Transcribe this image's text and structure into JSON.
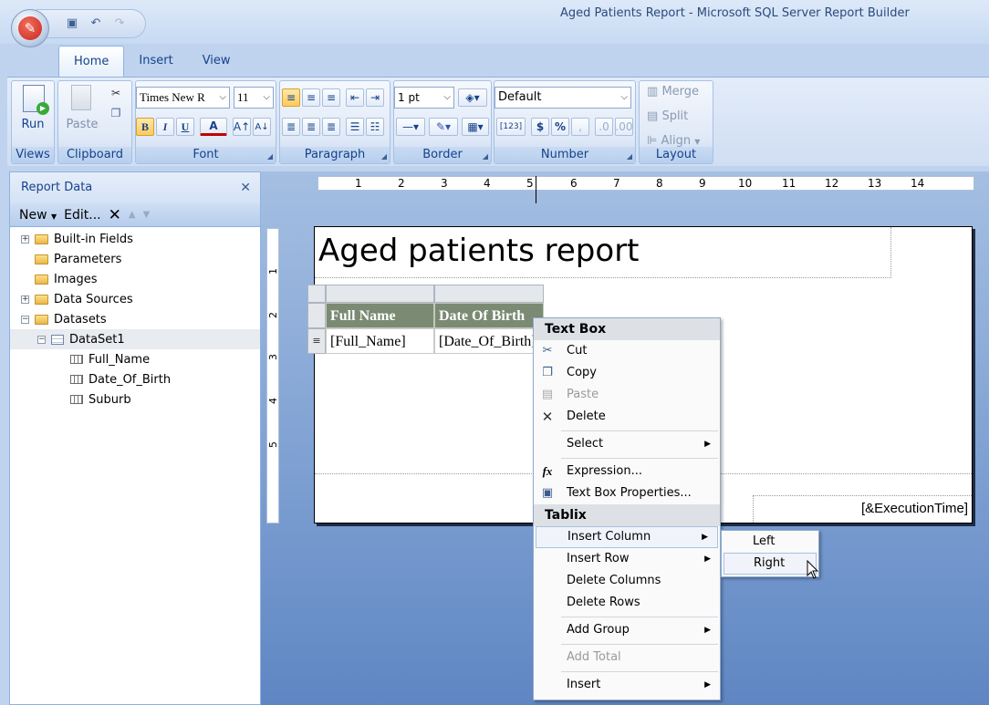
{
  "window": {
    "title": "Aged Patients Report - Microsoft SQL Server Report Builder"
  },
  "qat": {
    "icons": [
      "save-icon",
      "undo-icon",
      "redo-icon"
    ]
  },
  "tabs": [
    {
      "label": "Home"
    },
    {
      "label": "Insert"
    },
    {
      "label": "View"
    }
  ],
  "ribbon": {
    "views": {
      "run": "Run",
      "label": "Views"
    },
    "clipboard": {
      "paste": "Paste",
      "label": "Clipboard"
    },
    "font": {
      "family": "Times New R",
      "size": "11",
      "label": "Font",
      "bold": "B",
      "italic": "I",
      "underline": "U",
      "color": "A"
    },
    "paragraph": {
      "label": "Paragraph"
    },
    "border": {
      "width": "1 pt",
      "label": "Border"
    },
    "number": {
      "format": "Default",
      "label": "Number",
      "placeholder_btn": "[123]",
      "currency": "$",
      "percent": "%",
      "comma": ","
    },
    "layout": {
      "merge": "Merge",
      "split": "Split",
      "align": "Align",
      "label": "Layout"
    }
  },
  "report_data": {
    "title": "Report Data",
    "toolbar": {
      "new": "New",
      "edit": "Edit..."
    },
    "tree": [
      {
        "label": "Built-in Fields",
        "expander": "+"
      },
      {
        "label": "Parameters",
        "expander": ""
      },
      {
        "label": "Images",
        "expander": ""
      },
      {
        "label": "Data Sources",
        "expander": "+"
      },
      {
        "label": "Datasets",
        "expander": "−"
      },
      {
        "label": "DataSet1",
        "expander": "−"
      },
      {
        "label": "Full_Name"
      },
      {
        "label": "Date_Of_Birth"
      },
      {
        "label": "Suburb"
      }
    ]
  },
  "ruler": {
    "h": [
      "1",
      "2",
      "3",
      "4",
      "5",
      "6",
      "7",
      "8",
      "9",
      "10",
      "11",
      "12",
      "13",
      "14"
    ],
    "v": [
      "1",
      "2",
      "3",
      "4",
      "5"
    ]
  },
  "report": {
    "title": "Aged patients report",
    "exec_time": "[&ExecutionTime]",
    "headers": [
      "Full Name",
      "Date Of Birth"
    ],
    "cells": [
      "[Full_Name]",
      "[Date_Of_Birth]"
    ],
    "row_handle": "≡"
  },
  "context_menu": {
    "textbox_head": "Text Box",
    "cut": "Cut",
    "copy": "Copy",
    "paste": "Paste",
    "delete": "Delete",
    "select": "Select",
    "expression": "Expression...",
    "props": "Text Box Properties...",
    "tablix_head": "Tablix",
    "insert_column": "Insert Column",
    "insert_row": "Insert Row",
    "delete_columns": "Delete Columns",
    "delete_rows": "Delete Rows",
    "add_group": "Add Group",
    "add_total": "Add Total",
    "insert": "Insert"
  },
  "submenu": {
    "left": "Left",
    "right": "Right"
  }
}
